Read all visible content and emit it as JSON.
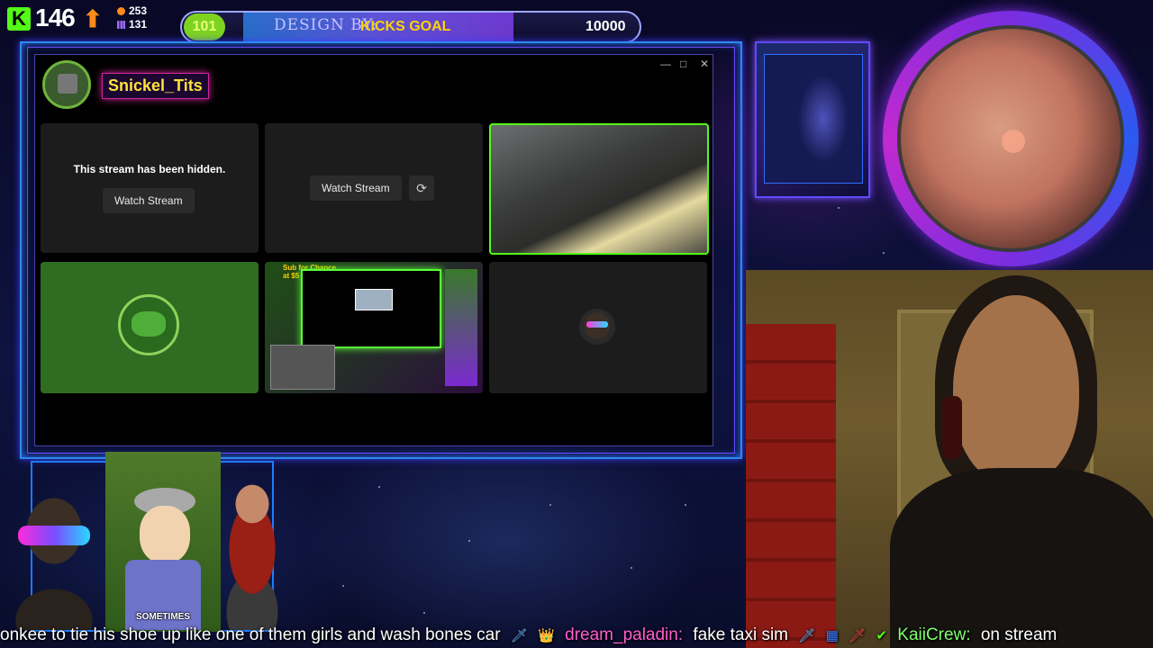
{
  "hud": {
    "followers": "146",
    "stat_top": "253",
    "stat_bottom": "131",
    "goal_current": "101",
    "goal_design_text": "DESIGN BY:",
    "goal_label": "KICKS GOAL",
    "goal_target": "10000"
  },
  "window": {
    "username": "Snickel_Tits",
    "minimize": "—",
    "maximize": "□",
    "close": "✕",
    "tiles": {
      "hidden_message": "This stream has been hidden.",
      "watch_label_1": "Watch Stream",
      "watch_label_2": "Watch Stream"
    }
  },
  "overlay_preview": {
    "caption": "Sub for Chance at $5"
  },
  "bottom_left": {
    "sp_caption": "SOMETIMES"
  },
  "chat": {
    "message_1": "onkee to tie his shoe up like one of them girls and wash bones car",
    "user_2": "dream_paladin:",
    "message_2": "fake taxi sim",
    "user_3": "KaiiCrew:",
    "message_3": "on stream"
  },
  "colors": {
    "kick_green": "#53fc18",
    "goal_label": "#ffd400",
    "username": "#ffe23b"
  },
  "icons": {
    "kick": "kick-logo-icon",
    "arrow": "up-arrow-icon",
    "refresh": "refresh-icon",
    "mute": "mute-icon"
  }
}
